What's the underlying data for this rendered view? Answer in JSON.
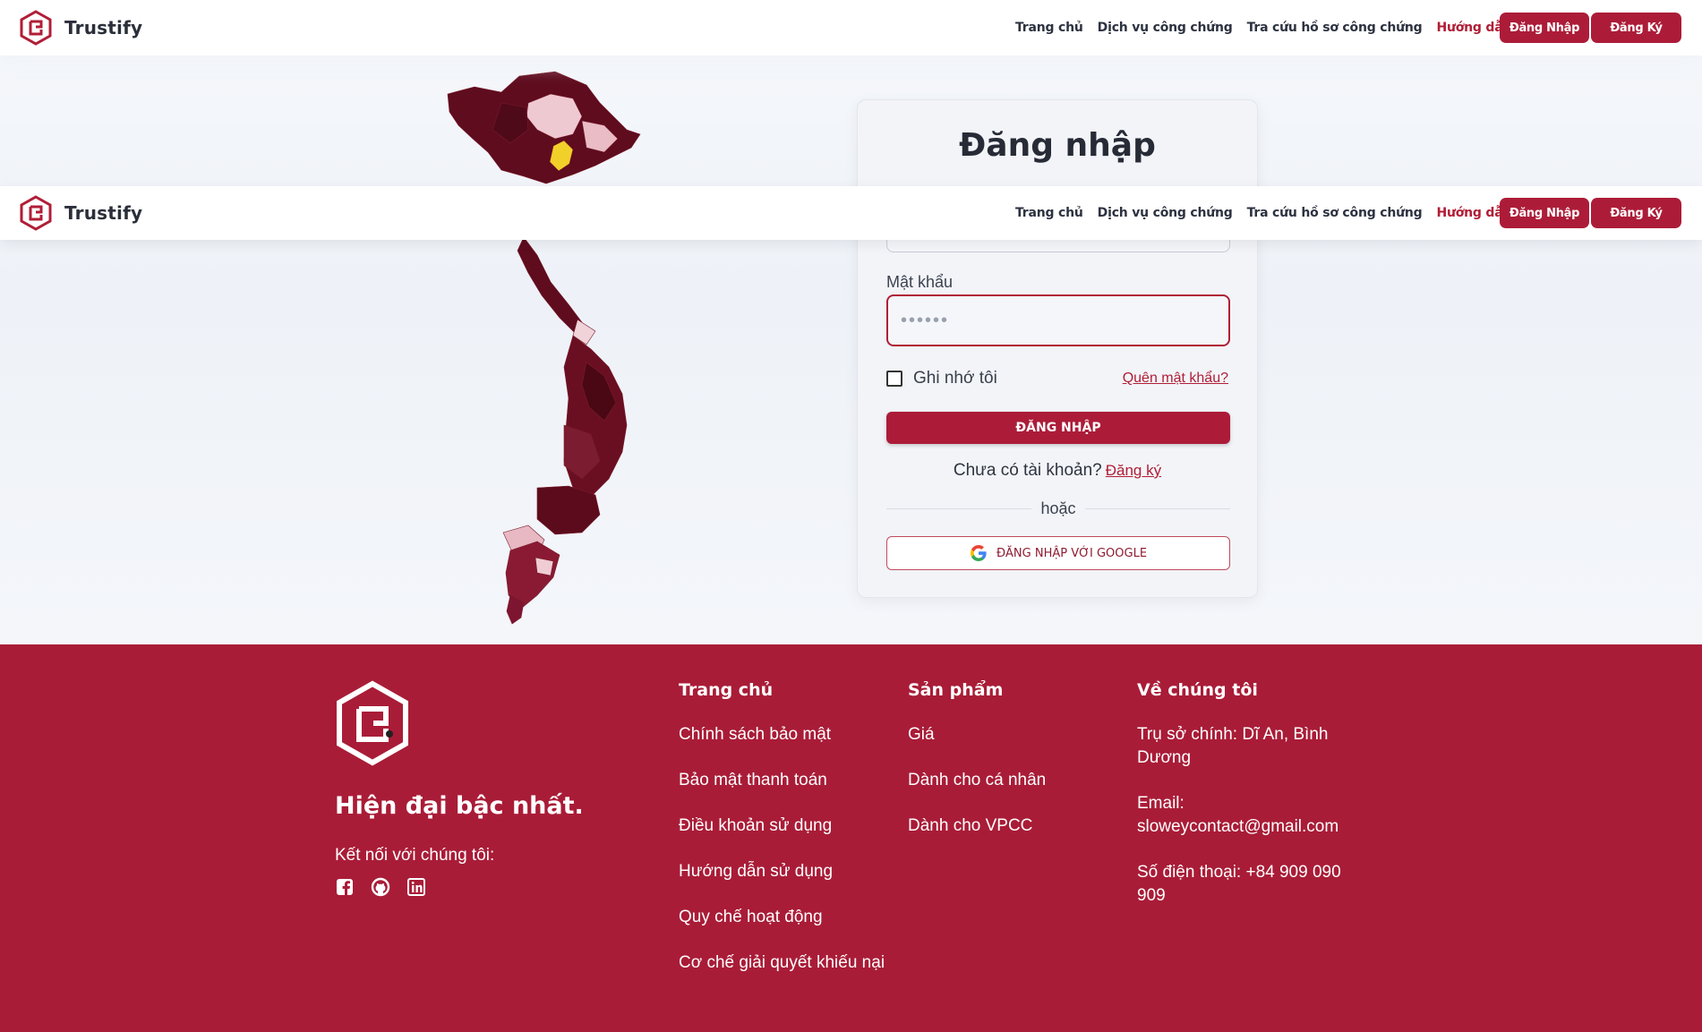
{
  "header": {
    "brand": "Trustify",
    "nav": [
      "Trang chủ",
      "Dịch vụ công chứng",
      "Tra cứu hồ sơ công chứng",
      "Hướng dẫn"
    ],
    "login_label": "Đăng Nhập",
    "register_label": "Đăng Ký"
  },
  "login": {
    "title": "Đăng nhập",
    "password_label": "Mật khẩu",
    "password_value": "••••••",
    "remember_label": "Ghi nhớ tôi",
    "forgot_link": "Quên mật khẩu?",
    "submit_label": "ĐĂNG NHẬP",
    "no_account_text": "Chưa có tài khoản?",
    "register_link": "Đăng ký",
    "or_text": "hoặc",
    "google_label": "ĐĂNG NHẬP VỚI GOOGLE"
  },
  "footer": {
    "tagline": "Hiện đại bậc nhất.",
    "connect": "Kết nối với chúng tôi:",
    "social_icons": [
      "facebook-icon",
      "github-icon",
      "linkedin-icon"
    ],
    "columns": [
      {
        "title": "Trang chủ",
        "items": [
          "Chính sách bảo mật",
          "Bảo mật thanh toán",
          "Điều khoản sử dụng",
          "Hướng dẫn sử dụng",
          "Quy chế hoạt động",
          "Cơ chế giải quyết khiếu nại"
        ]
      },
      {
        "title": "Sản phẩm",
        "items": [
          "Giá",
          "Dành cho cá nhân",
          "Dành cho VPCC"
        ]
      },
      {
        "title": "Về chúng tôi",
        "items": [
          "Trụ sở chính: Dĩ An, Bình Dương",
          "Email: sloweycontact@gmail.com",
          "Số điện thoại: +84 909 090 909"
        ]
      }
    ]
  },
  "colors": {
    "primary": "#ac1c38",
    "map_dark": "#5e0c1e",
    "map_light": "#efc9d1",
    "map_highlight": "#f2d02a"
  }
}
